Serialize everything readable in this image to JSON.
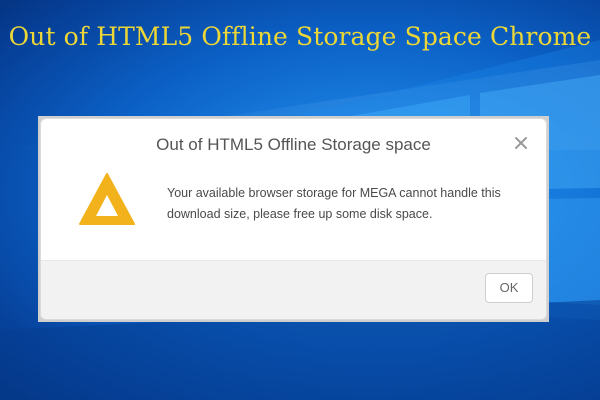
{
  "headline": "Out of HTML5 Offline Storage Space Chrome",
  "dialog": {
    "title": "Out of HTML5 Offline Storage space",
    "close_icon": "close-icon",
    "warning_icon": "warning-triangle-icon",
    "message_line1": "Your available browser storage for MEGA cannot handle this",
    "message_line2": "download size, please free up some disk space.",
    "ok_label": "OK"
  },
  "colors": {
    "headline": "#ecd736",
    "warning": "#f2b21b",
    "desktop_blue": "#0b63c6"
  }
}
